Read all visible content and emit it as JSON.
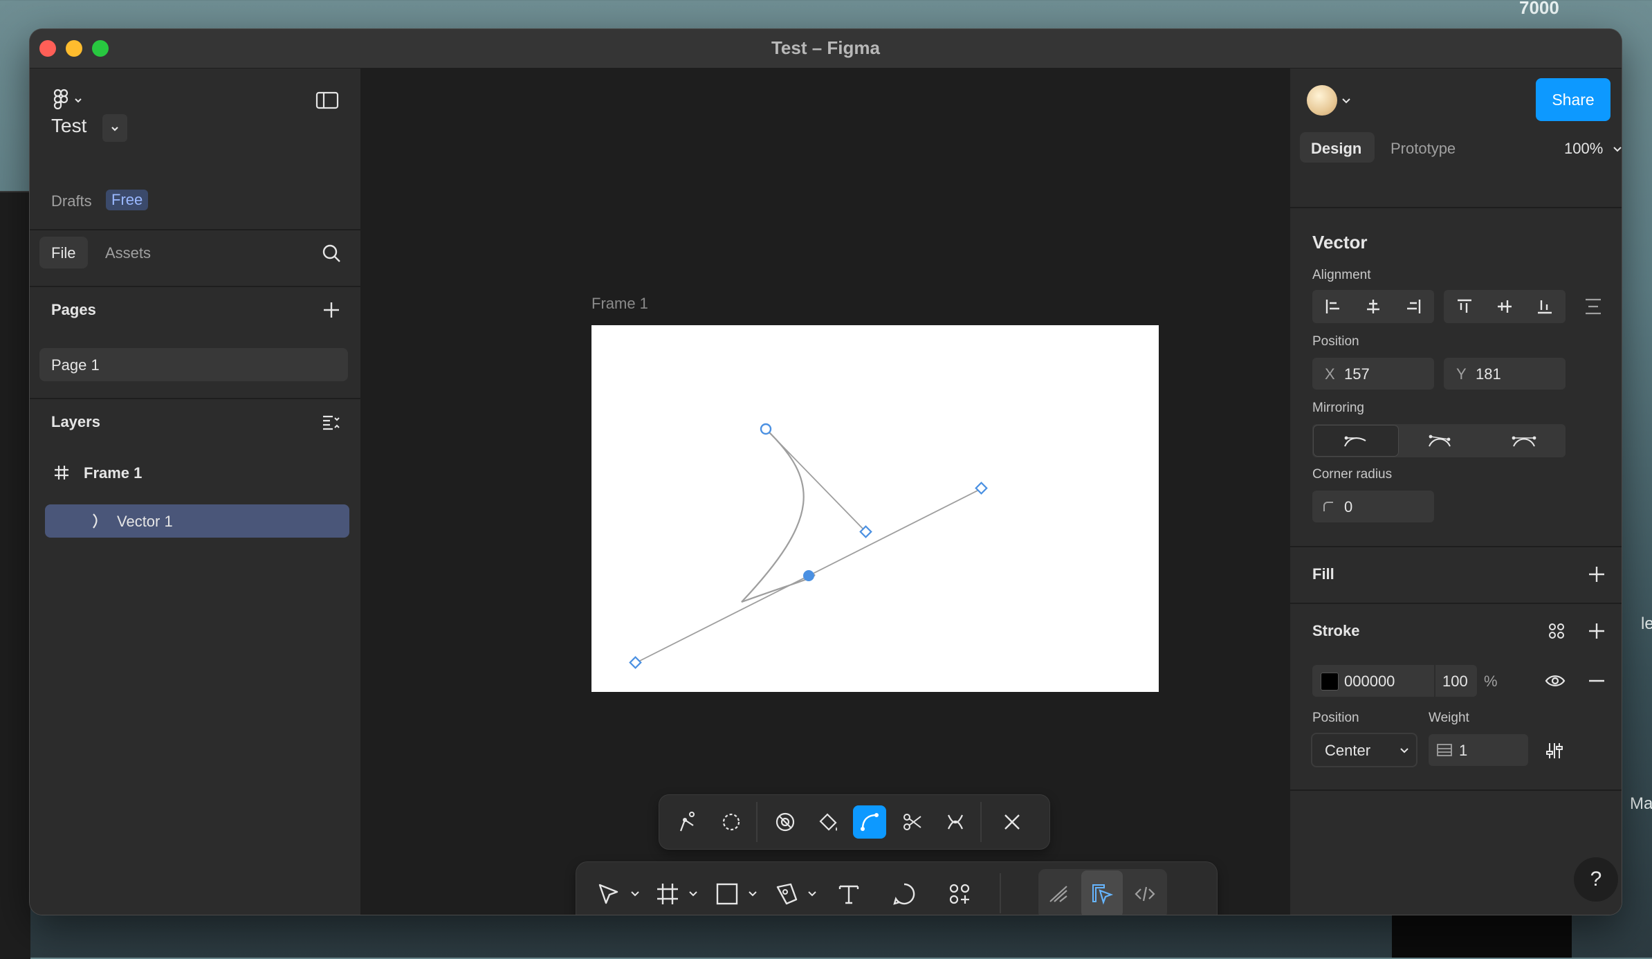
{
  "desktop": {
    "corner_number": "7000",
    "edge_text_1": "le",
    "edge_text_2": "Ma"
  },
  "window": {
    "title": "Test – Figma"
  },
  "left_panel": {
    "project": {
      "name": "Test",
      "location": "Drafts",
      "plan_badge": "Free"
    },
    "tabs": [
      {
        "label": "File",
        "active": true
      },
      {
        "label": "Assets",
        "active": false
      }
    ],
    "pages": {
      "header": "Pages",
      "items": [
        {
          "label": "Page 1",
          "selected": true
        }
      ]
    },
    "layers": {
      "header": "Layers",
      "items": [
        {
          "label": "Frame 1",
          "icon": "frame-hash-icon",
          "selected": false
        },
        {
          "label": "Vector 1",
          "icon": "vector-path-icon",
          "selected": true
        }
      ]
    }
  },
  "canvas": {
    "frame_label": "Frame 1",
    "selection_color": "#4a90e2",
    "stroke_color": "#9e9e9e",
    "edit_tools": [
      "bend-tool-icon",
      "lasso-icon",
      "shape-builder-icon",
      "paint-bucket-icon",
      "bend-path-icon",
      "cut-icon",
      "shape-path-icon",
      "close-icon"
    ],
    "edit_tools_active": "bend-path-icon",
    "main_tools": [
      "move-icon",
      "frame-icon",
      "rectangle-icon",
      "pen-icon",
      "text-icon",
      "comment-icon",
      "assets-icon",
      "draw-mode-icon",
      "design-mode-icon",
      "dev-mode-icon"
    ]
  },
  "right_panel": {
    "share_label": "Share",
    "tabs": [
      {
        "label": "Design",
        "active": true
      },
      {
        "label": "Prototype",
        "active": false
      }
    ],
    "zoom": "100%",
    "section_title": "Vector",
    "alignment_label": "Alignment",
    "position_label": "Position",
    "x_label": "X",
    "x_value": "157",
    "y_label": "Y",
    "y_value": "181",
    "mirroring_label": "Mirroring",
    "corner_radius_label": "Corner radius",
    "corner_radius_value": "0",
    "fill_label": "Fill",
    "stroke": {
      "label": "Stroke",
      "color_hex": "000000",
      "opacity": "100",
      "percent_sign": "%",
      "position_label": "Position",
      "position_value": "Center",
      "weight_label": "Weight",
      "weight_value": "1"
    },
    "help_label": "?"
  },
  "colors": {
    "accent": "#0d99ff",
    "panel_bg": "#2c2c2c",
    "canvas_bg": "#1e1e1e",
    "selected_layer": "#4a5679"
  }
}
